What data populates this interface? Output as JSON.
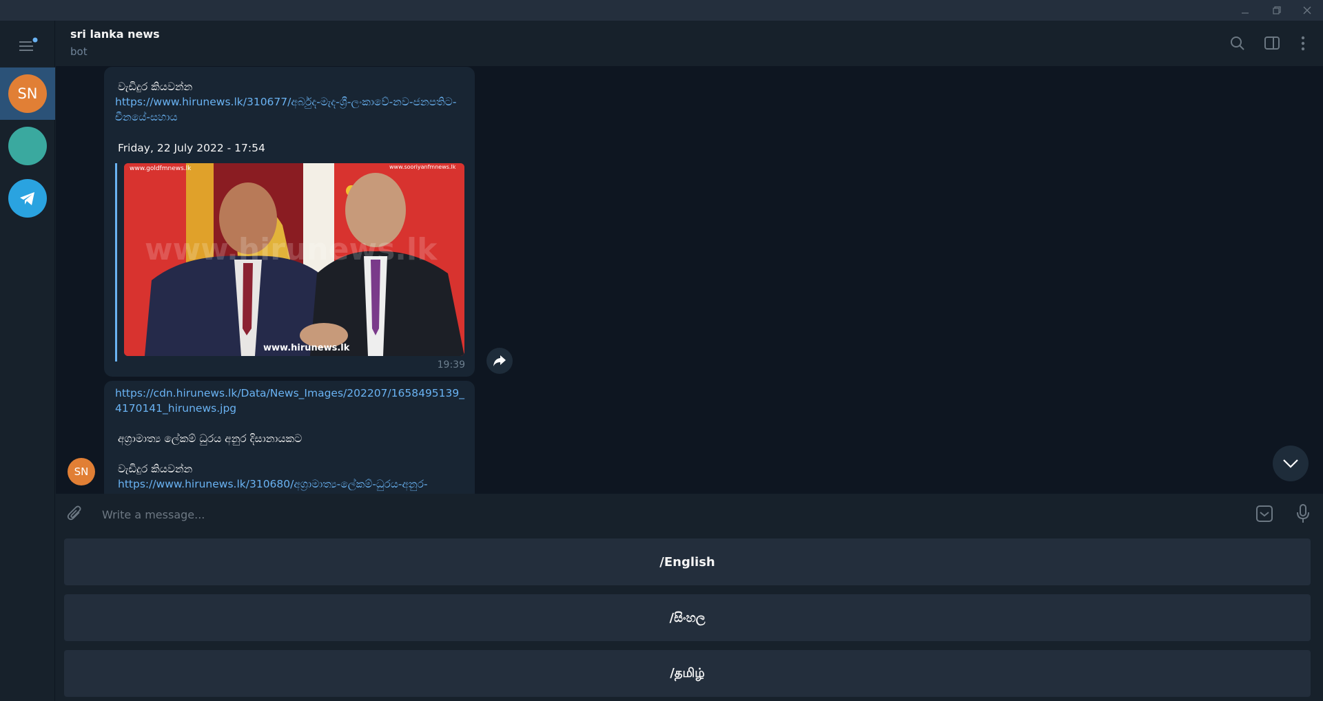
{
  "chat": {
    "title": "sri lanka news",
    "status": "bot"
  },
  "rail": {
    "items": [
      {
        "initials": "SN",
        "color": "#e17f35",
        "active": true
      },
      {
        "initials": "",
        "color": "#3aa99f",
        "active": false
      },
      {
        "icon": "telegram-icon",
        "color": "#2aa3e0",
        "active": false
      }
    ]
  },
  "messages": [
    {
      "read_more": "වැඩිදුර කියවන්න",
      "link": "https://www.hirunews.lk/310677/අර්බුද-මැද-ශ්‍රී-ලංකාවේ-නව-ජනපතිට-චීනයේ-සහාය",
      "date": "Friday, 22 July 2022 - 17:54",
      "image": {
        "watermark_left": "www.goldfmnews.lk",
        "watermark_right": "www.sooriyanfmnews.lk",
        "watermark_center": "www.hirunews.lk",
        "caption": "www.hirunews.lk"
      },
      "time": "19:39"
    },
    {
      "image_link": "https://cdn.hirunews.lk/Data/News_Images/202207/1658495139_4170141_hirunews.jpg",
      "headline": "අග්‍රාමාත්‍ය ලේකම් ධුරය අනුර දිසානායකට",
      "read_more": "වැඩිදුර කියවන්න",
      "link": "https://www.hirunews.lk/310680/අග්‍රාමාත්‍ය-ලේකම්-ධුරය-අනුර-",
      "sender_initials": "SN"
    }
  ],
  "composer": {
    "placeholder": "Write a message..."
  },
  "keyboard": {
    "buttons": [
      "/English",
      "/සිංහල",
      "/தமிழ்"
    ]
  },
  "colors": {
    "accent": "#6ab3f3",
    "background": "#0e1621",
    "panel": "#17212b",
    "bubble": "#182533",
    "avatar_orange": "#e17f35"
  }
}
